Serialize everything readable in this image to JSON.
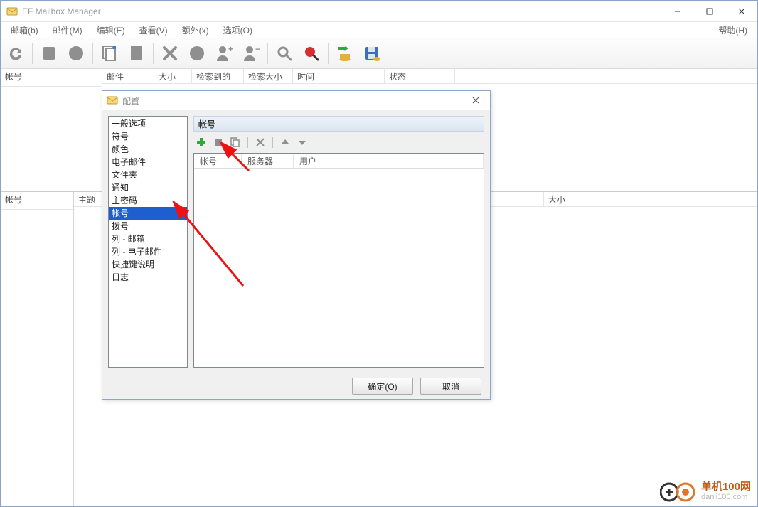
{
  "title": "EF Mailbox Manager",
  "menu": {
    "mailbox": "邮箱(b)",
    "mail": "邮件(M)",
    "edit": "编辑(E)",
    "view": "查看(V)",
    "extra": "额外(x)",
    "options": "选项(O)",
    "help": "帮助(H)"
  },
  "upper": {
    "accounts_header": "帐号",
    "columns": {
      "mail": "邮件",
      "size": "大小",
      "retrieved": "检索到的",
      "retrieve_size": "检索大小",
      "time": "时间",
      "status": "状态"
    }
  },
  "lower": {
    "accounts_header": "帐号",
    "columns": {
      "subject": "主题",
      "size": "大小"
    }
  },
  "dialog": {
    "title": "配置",
    "section_title": "帐号",
    "tree": [
      "一般选项",
      "符号",
      "颜色",
      "电子邮件",
      "文件夹",
      "通知",
      "主密码",
      "帐号",
      "拨号",
      "列 - 邮箱",
      "列 - 电子邮件",
      "快捷键说明",
      "日志"
    ],
    "tree_selected": "帐号",
    "list_columns": {
      "account": "帐号",
      "server": "服务器",
      "user": "用户"
    },
    "ok": "确定(O)",
    "cancel": "取消"
  },
  "watermark": {
    "line1": "单机100网",
    "line2": "danji100.com"
  }
}
